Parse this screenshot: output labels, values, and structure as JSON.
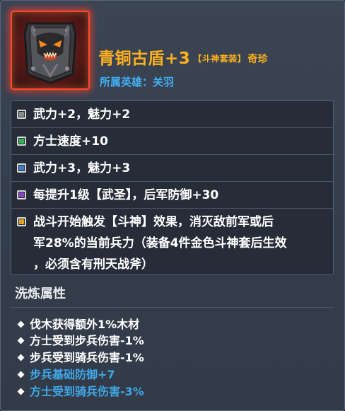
{
  "item": {
    "name": "青铜古盾+3",
    "set_tag": "【斗神套装】",
    "rarity": "奇珍",
    "hero_label": "所属英雄：关羽",
    "icon": "bronze-demon-shield-icon"
  },
  "stats": [
    {
      "text": "武力+2，魅力+2",
      "color": "#8a8a8a"
    },
    {
      "text": "方士速度+10",
      "color": "#33b34a"
    },
    {
      "text": "武力+3，魅力+3",
      "color": "#3f7fc4"
    },
    {
      "text": "每提升1级【武圣】，后军防御+30",
      "color": "#8a3fc4"
    },
    {
      "text": "战斗开始触发【斗神】效果，消灭敌前军或后\n军28%的当前兵力（装备4件金色斗神套后生效\n，必须含有刑天战斧）",
      "color": "#e0a21e"
    }
  ],
  "refine": {
    "title": "洗炼属性",
    "items": [
      {
        "text": "伐木获得额外1%木材",
        "color": "#ffffff"
      },
      {
        "text": "方士受到步兵伤害-1%",
        "color": "#ffffff"
      },
      {
        "text": "步兵受到骑兵伤害-1%",
        "color": "#ffffff"
      },
      {
        "text": "步兵基础防御+7",
        "color": "#3fa7e8"
      },
      {
        "text": "方士受到骑兵伤害-3%",
        "color": "#3fa7e8"
      }
    ]
  },
  "colors": {
    "gold": "#ffb11e",
    "hero_blue": "#44aef0",
    "refine_blue": "#3fa7e8"
  }
}
